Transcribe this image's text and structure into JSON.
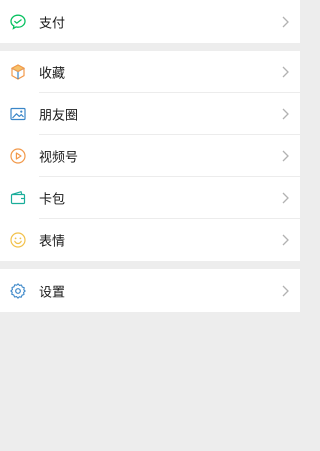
{
  "colors": {
    "background": "#ededed",
    "row": "#ffffff",
    "text": "#191919",
    "chevron": "#b2b2b2",
    "pay": "#07c160",
    "favorites": "#f2994a",
    "moments": "#3a86c8",
    "channels": "#f2994a",
    "cards": "#1aad9a",
    "stickers": "#f2c14a",
    "settings": "#3a86c8"
  },
  "groups": [
    {
      "items": [
        {
          "id": "pay",
          "label": "支付",
          "icon": "pay-icon"
        }
      ]
    },
    {
      "items": [
        {
          "id": "favorites",
          "label": "收藏",
          "icon": "favorites-cube-icon"
        },
        {
          "id": "moments",
          "label": "朋友圈",
          "icon": "moments-picture-icon"
        },
        {
          "id": "channels",
          "label": "视频号",
          "icon": "channels-play-icon"
        },
        {
          "id": "cards",
          "label": "卡包",
          "icon": "card-wallet-icon"
        },
        {
          "id": "stickers",
          "label": "表情",
          "icon": "smiley-icon"
        }
      ]
    },
    {
      "items": [
        {
          "id": "settings",
          "label": "设置",
          "icon": "gear-icon"
        }
      ]
    }
  ]
}
